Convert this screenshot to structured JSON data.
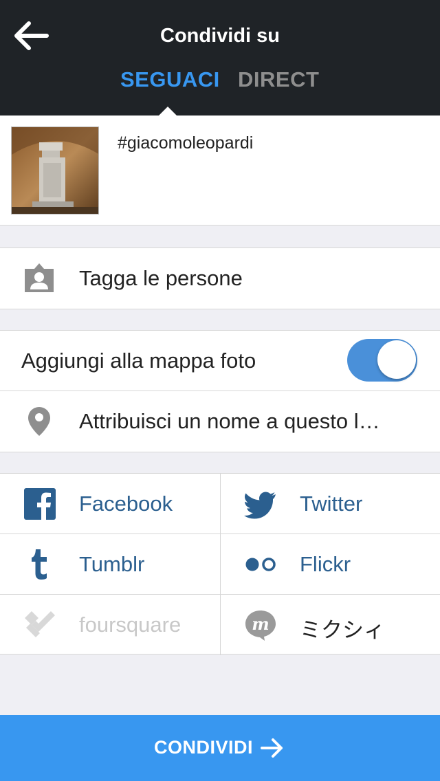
{
  "header": {
    "title": "Condividi su",
    "tabs": [
      {
        "label": "SEGUACI",
        "active": true
      },
      {
        "label": "DIRECT",
        "active": false
      }
    ]
  },
  "post": {
    "caption": "#giacomoleopardi"
  },
  "options": {
    "tag_people": "Tagga le persone",
    "add_to_map": "Aggiungi alla mappa foto",
    "add_to_map_enabled": true,
    "location_placeholder": "Attribuisci un nome a questo l…"
  },
  "share_targets": [
    {
      "label": "Facebook",
      "icon": "facebook-icon"
    },
    {
      "label": "Twitter",
      "icon": "twitter-icon"
    },
    {
      "label": "Tumblr",
      "icon": "tumblr-icon"
    },
    {
      "label": "Flickr",
      "icon": "flickr-icon"
    },
    {
      "label": "foursquare",
      "icon": "foursquare-icon",
      "disabled": true
    },
    {
      "label": "ミクシィ",
      "icon": "mixi-icon"
    }
  ],
  "footer": {
    "share_label": "CONDIVIDI"
  },
  "colors": {
    "header_bg": "#1f2327",
    "accent": "#3897f0",
    "link": "#2b5f8f",
    "toggle_on": "#4a90d9"
  }
}
